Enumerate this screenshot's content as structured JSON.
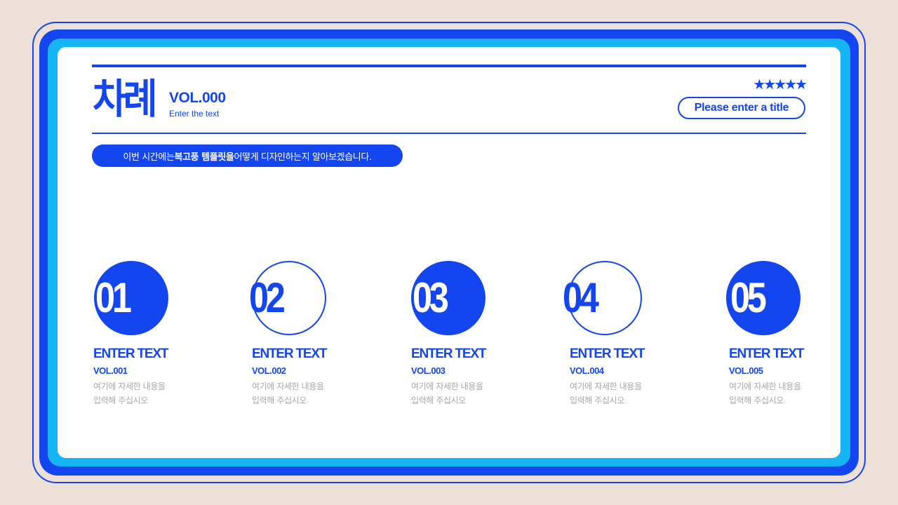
{
  "colors": {
    "background": "#ede0d8",
    "accent": "#1446f0",
    "light_accent": "#16b6f5",
    "card": "#ffffff",
    "muted_text": "#a8a8a8"
  },
  "header": {
    "heading": "차례",
    "vol": "VOL.000",
    "sub": "Enter the text",
    "stars": "★★★★★",
    "title_button": "Please enter a title"
  },
  "intro": {
    "before": "이번 시간에는 ",
    "bold": "복고풍 템플릿을",
    "after": " 어떻게 디자인하는지 알아보겠습니다."
  },
  "items": [
    {
      "num": "01",
      "title": "ENTER TEXT",
      "vol": "VOL.001",
      "desc_1": "여기에 자세한 내용을",
      "desc_2": "입력해 주십시오",
      "style": "filled"
    },
    {
      "num": "02",
      "title": "ENTER TEXT",
      "vol": "VOL.002",
      "desc_1": "여기에 자세한 내용을",
      "desc_2": "입력해 주십시오",
      "style": "outline"
    },
    {
      "num": "03",
      "title": "ENTER TEXT",
      "vol": "VOL.003",
      "desc_1": "여기에 자세한 내용을",
      "desc_2": "입력해 주십시오",
      "style": "filled"
    },
    {
      "num": "04",
      "title": "ENTER TEXT",
      "vol": "VOL.004",
      "desc_1": "여기에 자세한 내용을",
      "desc_2": "입력해 주십시오",
      "style": "outline"
    },
    {
      "num": "05",
      "title": "ENTER TEXT",
      "vol": "VOL.005",
      "desc_1": "여기에 자세한 내용을",
      "desc_2": "입력해 주십시오",
      "style": "filled"
    }
  ]
}
